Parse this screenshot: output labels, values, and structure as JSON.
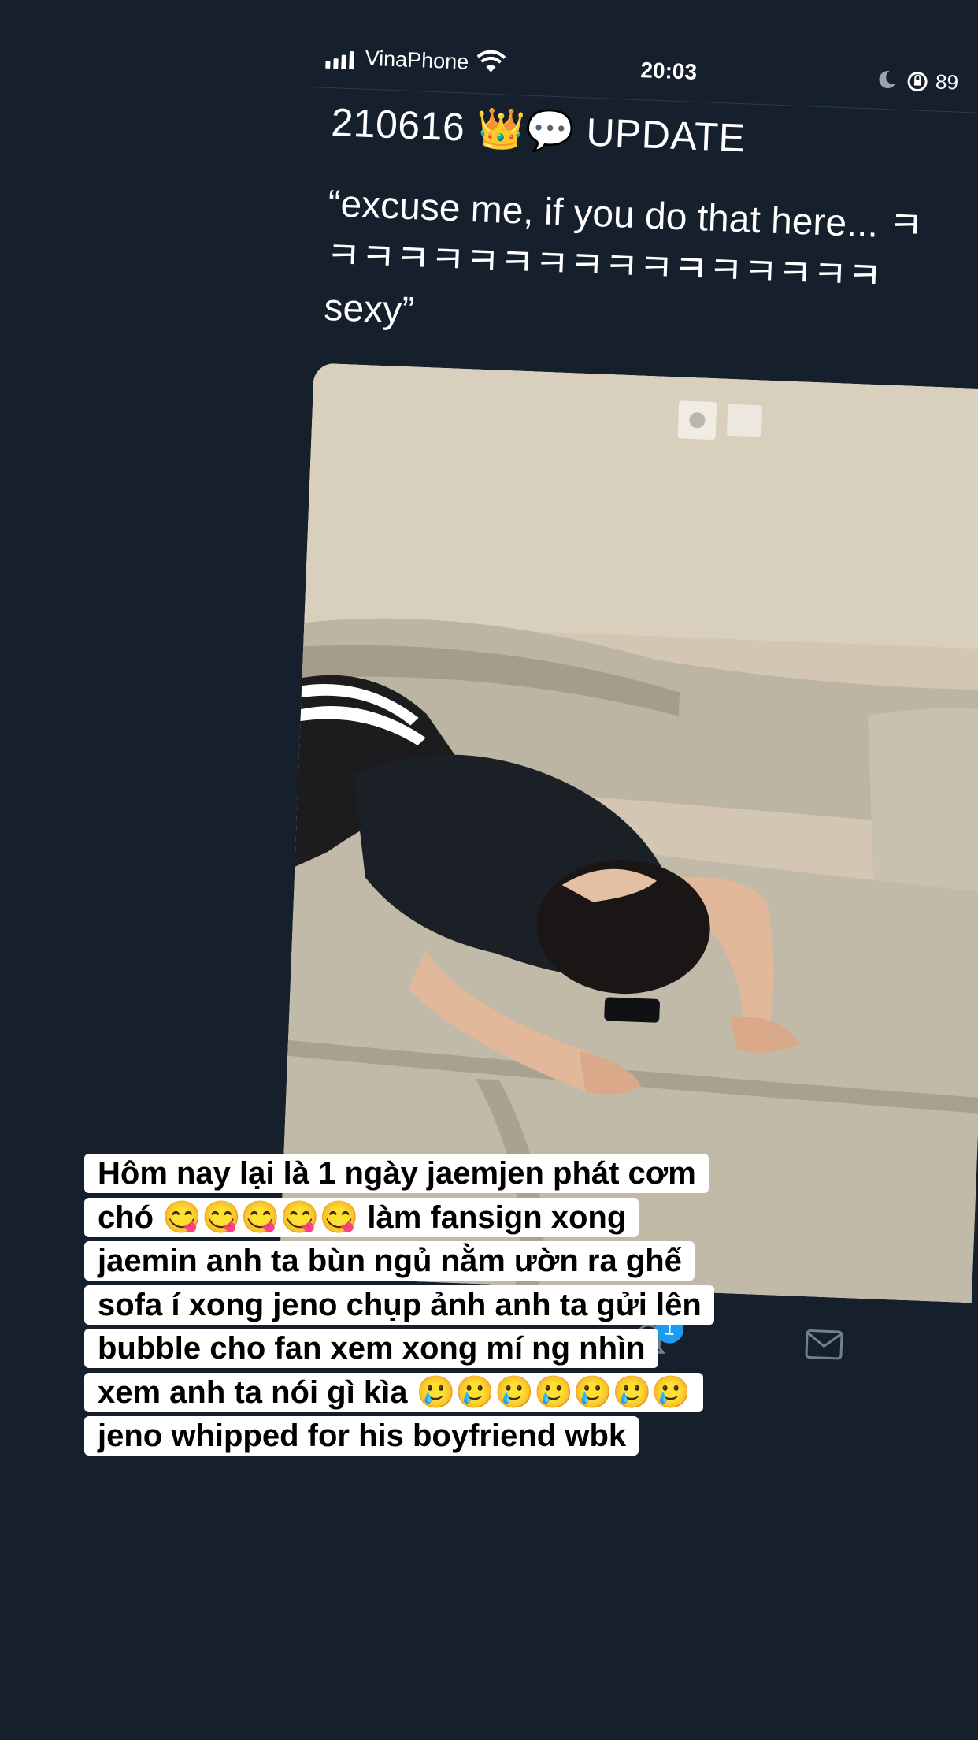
{
  "status_bar": {
    "carrier": "VinaPhone",
    "time": "20:03",
    "battery": "89"
  },
  "tweet": {
    "header": "210616 👑💬 UPDATE",
    "body": "“excuse me, if you do that here... ㅋㅋㅋㅋㅋㅋㅋㅋㅋㅋㅋㅋㅋㅋㅋㅋㅋ sexy”"
  },
  "tab_bar": {
    "notification_count": "1",
    "icons": [
      "bell-icon",
      "mail-icon"
    ]
  },
  "caption": {
    "text": "Hôm nay lại là 1 ngày jaemjen phát cơm chó 😋😋😋😋😋 làm fansign xong jaemin anh ta bùn ngủ nằm ườn ra ghế sofa í xong jeno chụp ảnh anh ta gửi lên bubble cho fan xem xong mí ng nhìn xem anh ta nói gì kìa 🥲🥲🥲🥲🥲🥲🥲 jeno whipped for his boyfriend wbk"
  },
  "colors": {
    "background": "#161f2c",
    "badge": "#1d9bf0",
    "caption_bg": "#ffffff"
  }
}
